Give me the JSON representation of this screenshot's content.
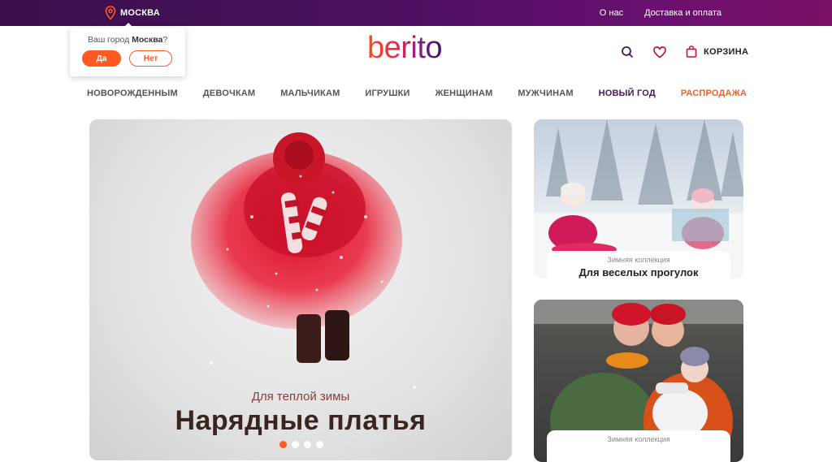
{
  "topbar": {
    "city": "МОСКВА",
    "links": [
      "О нас",
      "Доставка и оплата"
    ]
  },
  "city_popup": {
    "question_prefix": "Ваш город ",
    "city": "Москва",
    "question_suffix": "?",
    "yes": "Да",
    "no": "Нет"
  },
  "header": {
    "logo": "berito",
    "cart": "КОРЗИНА",
    "icons": [
      "search-icon",
      "heart-icon",
      "bag-icon"
    ]
  },
  "nav": [
    "НОВОРОЖДЕННЫМ",
    "ДЕВОЧКАМ",
    "МАЛЬЧИКАМ",
    "ИГРУШКИ",
    "ЖЕНЩИНАМ",
    "МУЖЧИНАМ",
    "НОВЫЙ ГОД",
    "РАСПРОДАЖА"
  ],
  "hero": {
    "subtitle": "Для теплой зимы",
    "title": "Нарядные платья",
    "slides": 4,
    "active_slide": 1
  },
  "cards": [
    {
      "small": "Зимняя коллекция",
      "big": "Для веселых прогулок"
    },
    {
      "small": "Зимняя коллекция",
      "big": ""
    }
  ],
  "colors": {
    "accent": "#ff5a1f",
    "brand_purple": "#4a1466"
  }
}
